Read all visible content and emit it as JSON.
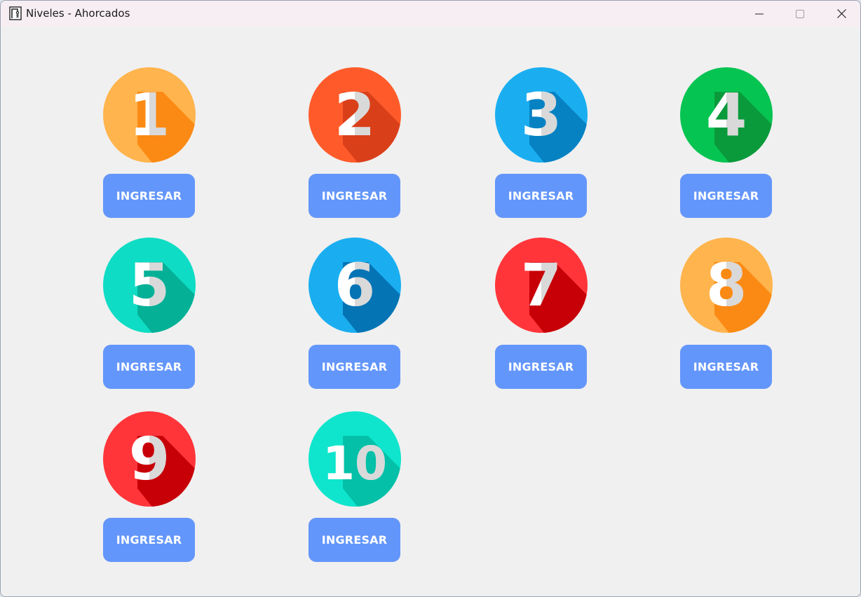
{
  "window": {
    "title": "Niveles - Ahorcados"
  },
  "icons": {
    "app": "gallows-app-icon",
    "minimize": "minimize-icon",
    "maximize": "maximize-icon",
    "close": "close-icon"
  },
  "levels": [
    {
      "number": "1",
      "button": "INGRESAR",
      "color": "#ffb44d",
      "shade": "#fb8a14"
    },
    {
      "number": "2",
      "button": "INGRESAR",
      "color": "#ff5b2a",
      "shade": "#d9401a"
    },
    {
      "number": "3",
      "button": "INGRESAR",
      "color": "#1aaef0",
      "shade": "#0682c3"
    },
    {
      "number": "4",
      "button": "INGRESAR",
      "color": "#06c452",
      "shade": "#0a9a3c"
    },
    {
      "number": "5",
      "button": "INGRESAR",
      "color": "#0fdcc4",
      "shade": "#04b096"
    },
    {
      "number": "6",
      "button": "INGRESAR",
      "color": "#1aaef0",
      "shade": "#0574b4"
    },
    {
      "number": "7",
      "button": "INGRESAR",
      "color": "#ff353a",
      "shade": "#c70008"
    },
    {
      "number": "8",
      "button": "INGRESAR",
      "color": "#ffb44d",
      "shade": "#fb8a14"
    },
    {
      "number": "9",
      "button": "INGRESAR",
      "color": "#ff353a",
      "shade": "#c70008"
    },
    {
      "number": "10",
      "button": "INGRESAR",
      "color": "#0fe5cc",
      "shade": "#04c0a8"
    }
  ],
  "colors": {
    "button": "#6396fb",
    "background": "#f0f0f0"
  }
}
